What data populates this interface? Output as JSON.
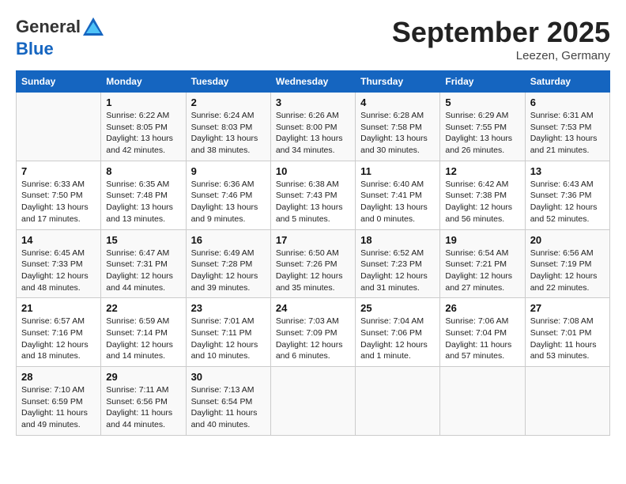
{
  "header": {
    "logo_line1": "General",
    "logo_line2": "Blue",
    "month": "September 2025",
    "location": "Leezen, Germany"
  },
  "columns": [
    "Sunday",
    "Monday",
    "Tuesday",
    "Wednesday",
    "Thursday",
    "Friday",
    "Saturday"
  ],
  "weeks": [
    [
      {
        "day": "",
        "sunrise": "",
        "sunset": "",
        "daylight": ""
      },
      {
        "day": "1",
        "sunrise": "6:22 AM",
        "sunset": "8:05 PM",
        "daylight": "13 hours and 42 minutes."
      },
      {
        "day": "2",
        "sunrise": "6:24 AM",
        "sunset": "8:03 PM",
        "daylight": "13 hours and 38 minutes."
      },
      {
        "day": "3",
        "sunrise": "6:26 AM",
        "sunset": "8:00 PM",
        "daylight": "13 hours and 34 minutes."
      },
      {
        "day": "4",
        "sunrise": "6:28 AM",
        "sunset": "7:58 PM",
        "daylight": "13 hours and 30 minutes."
      },
      {
        "day": "5",
        "sunrise": "6:29 AM",
        "sunset": "7:55 PM",
        "daylight": "13 hours and 26 minutes."
      },
      {
        "day": "6",
        "sunrise": "6:31 AM",
        "sunset": "7:53 PM",
        "daylight": "13 hours and 21 minutes."
      }
    ],
    [
      {
        "day": "7",
        "sunrise": "6:33 AM",
        "sunset": "7:50 PM",
        "daylight": "13 hours and 17 minutes."
      },
      {
        "day": "8",
        "sunrise": "6:35 AM",
        "sunset": "7:48 PM",
        "daylight": "13 hours and 13 minutes."
      },
      {
        "day": "9",
        "sunrise": "6:36 AM",
        "sunset": "7:46 PM",
        "daylight": "13 hours and 9 minutes."
      },
      {
        "day": "10",
        "sunrise": "6:38 AM",
        "sunset": "7:43 PM",
        "daylight": "13 hours and 5 minutes."
      },
      {
        "day": "11",
        "sunrise": "6:40 AM",
        "sunset": "7:41 PM",
        "daylight": "13 hours and 0 minutes."
      },
      {
        "day": "12",
        "sunrise": "6:42 AM",
        "sunset": "7:38 PM",
        "daylight": "12 hours and 56 minutes."
      },
      {
        "day": "13",
        "sunrise": "6:43 AM",
        "sunset": "7:36 PM",
        "daylight": "12 hours and 52 minutes."
      }
    ],
    [
      {
        "day": "14",
        "sunrise": "6:45 AM",
        "sunset": "7:33 PM",
        "daylight": "12 hours and 48 minutes."
      },
      {
        "day": "15",
        "sunrise": "6:47 AM",
        "sunset": "7:31 PM",
        "daylight": "12 hours and 44 minutes."
      },
      {
        "day": "16",
        "sunrise": "6:49 AM",
        "sunset": "7:28 PM",
        "daylight": "12 hours and 39 minutes."
      },
      {
        "day": "17",
        "sunrise": "6:50 AM",
        "sunset": "7:26 PM",
        "daylight": "12 hours and 35 minutes."
      },
      {
        "day": "18",
        "sunrise": "6:52 AM",
        "sunset": "7:23 PM",
        "daylight": "12 hours and 31 minutes."
      },
      {
        "day": "19",
        "sunrise": "6:54 AM",
        "sunset": "7:21 PM",
        "daylight": "12 hours and 27 minutes."
      },
      {
        "day": "20",
        "sunrise": "6:56 AM",
        "sunset": "7:19 PM",
        "daylight": "12 hours and 22 minutes."
      }
    ],
    [
      {
        "day": "21",
        "sunrise": "6:57 AM",
        "sunset": "7:16 PM",
        "daylight": "12 hours and 18 minutes."
      },
      {
        "day": "22",
        "sunrise": "6:59 AM",
        "sunset": "7:14 PM",
        "daylight": "12 hours and 14 minutes."
      },
      {
        "day": "23",
        "sunrise": "7:01 AM",
        "sunset": "7:11 PM",
        "daylight": "12 hours and 10 minutes."
      },
      {
        "day": "24",
        "sunrise": "7:03 AM",
        "sunset": "7:09 PM",
        "daylight": "12 hours and 6 minutes."
      },
      {
        "day": "25",
        "sunrise": "7:04 AM",
        "sunset": "7:06 PM",
        "daylight": "12 hours and 1 minute."
      },
      {
        "day": "26",
        "sunrise": "7:06 AM",
        "sunset": "7:04 PM",
        "daylight": "11 hours and 57 minutes."
      },
      {
        "day": "27",
        "sunrise": "7:08 AM",
        "sunset": "7:01 PM",
        "daylight": "11 hours and 53 minutes."
      }
    ],
    [
      {
        "day": "28",
        "sunrise": "7:10 AM",
        "sunset": "6:59 PM",
        "daylight": "11 hours and 49 minutes."
      },
      {
        "day": "29",
        "sunrise": "7:11 AM",
        "sunset": "6:56 PM",
        "daylight": "11 hours and 44 minutes."
      },
      {
        "day": "30",
        "sunrise": "7:13 AM",
        "sunset": "6:54 PM",
        "daylight": "11 hours and 40 minutes."
      },
      {
        "day": "",
        "sunrise": "",
        "sunset": "",
        "daylight": ""
      },
      {
        "day": "",
        "sunrise": "",
        "sunset": "",
        "daylight": ""
      },
      {
        "day": "",
        "sunrise": "",
        "sunset": "",
        "daylight": ""
      },
      {
        "day": "",
        "sunrise": "",
        "sunset": "",
        "daylight": ""
      }
    ]
  ]
}
